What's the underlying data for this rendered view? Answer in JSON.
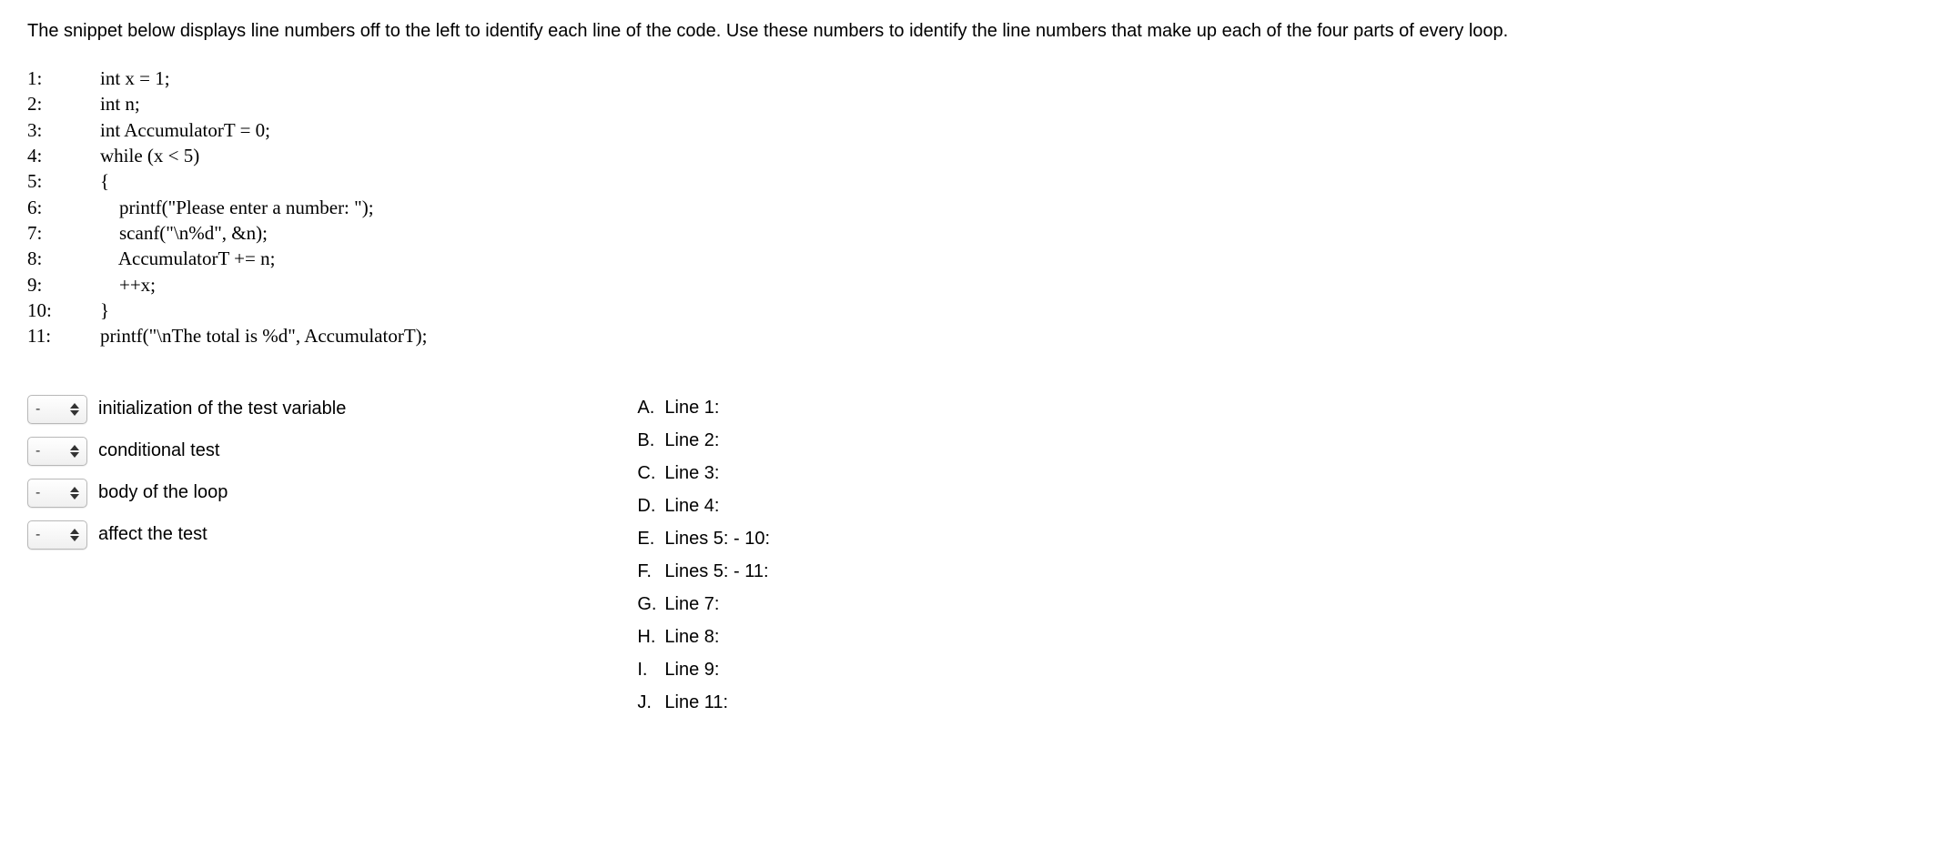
{
  "instructions": "The snippet below displays line numbers off to the left to identify each line of the code.  Use these numbers to identify the line numbers that make up each of the four parts of every loop.",
  "code": {
    "lines": [
      {
        "num": "1:",
        "text": "int x = 1;"
      },
      {
        "num": "2:",
        "text": "int n;"
      },
      {
        "num": "3:",
        "text": "int AccumulatorT = 0;"
      },
      {
        "num": "4:",
        "text": "while (x < 5)"
      },
      {
        "num": "5:",
        "text": "{"
      },
      {
        "num": "6:",
        "text": "    printf(\"Please enter a number: \");"
      },
      {
        "num": "7:",
        "text": "    scanf(\"\\n%d\", &n);"
      },
      {
        "num": "8:",
        "text": "    AccumulatorT += n;"
      },
      {
        "num": "9:",
        "text": "    ++x;"
      },
      {
        "num": "10:",
        "text": "}"
      },
      {
        "num": "11:",
        "text": "printf(\"\\nThe total is %d\", AccumulatorT);"
      }
    ]
  },
  "matching": {
    "default_value": "-",
    "items": [
      {
        "label": "initialization of the test variable"
      },
      {
        "label": "conditional test"
      },
      {
        "label": "body of the loop"
      },
      {
        "label": "affect the test"
      }
    ]
  },
  "choices": [
    {
      "letter": "A.",
      "text": "Line 1:"
    },
    {
      "letter": "B.",
      "text": "Line 2:"
    },
    {
      "letter": "C.",
      "text": "Line 3:"
    },
    {
      "letter": "D.",
      "text": "Line 4:"
    },
    {
      "letter": "E.",
      "text": "Lines 5: - 10:"
    },
    {
      "letter": "F.",
      "text": "Lines 5: - 11:"
    },
    {
      "letter": "G.",
      "text": "Line 7:"
    },
    {
      "letter": "H.",
      "text": "Line 8:"
    },
    {
      "letter": "I.",
      "text": "Line 9:"
    },
    {
      "letter": "J.",
      "text": "Line 11:"
    }
  ]
}
